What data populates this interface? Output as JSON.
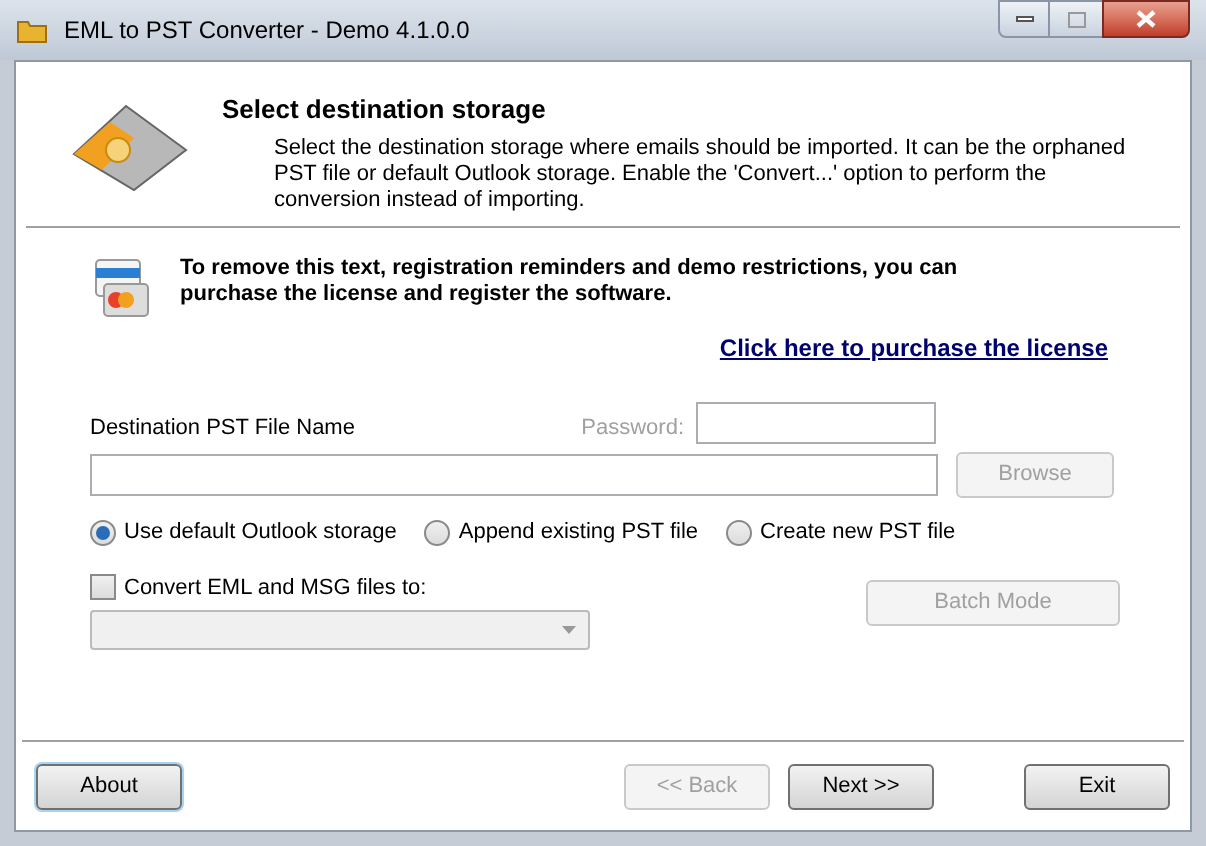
{
  "window": {
    "title": "EML to PST Converter - Demo 4.1.0.0"
  },
  "header": {
    "title": "Select destination storage",
    "description": "Select the destination storage where emails should be imported. It can be the orphaned PST file or default Outlook storage. Enable the 'Convert...' option to perform the conversion instead of importing."
  },
  "notice": {
    "text": "To remove this text, registration reminders and demo restrictions, you can purchase the license and register the software.",
    "link": "Click here to purchase the license"
  },
  "destination": {
    "label": "Destination PST File Name",
    "password_label": "Password:",
    "password_disabled": true,
    "browse": {
      "label": "Browse",
      "disabled": true
    }
  },
  "storage_options": [
    {
      "label": "Use default Outlook storage",
      "selected": true
    },
    {
      "label": "Append existing PST file",
      "selected": false
    },
    {
      "label": "Create new PST file",
      "selected": false
    }
  ],
  "convert": {
    "label": "Convert EML and MSG files to:",
    "checked": false,
    "format_disabled": true,
    "batch": {
      "label": "Batch Mode",
      "disabled": true
    }
  },
  "buttons": [
    {
      "label": "About",
      "kind": "focus",
      "disabled": false
    },
    {
      "label": "<< Back",
      "kind": "nav",
      "disabled": true
    },
    {
      "label": "Next >>",
      "kind": "nav",
      "disabled": false
    },
    {
      "label": "Exit",
      "kind": "exit",
      "disabled": false
    }
  ]
}
